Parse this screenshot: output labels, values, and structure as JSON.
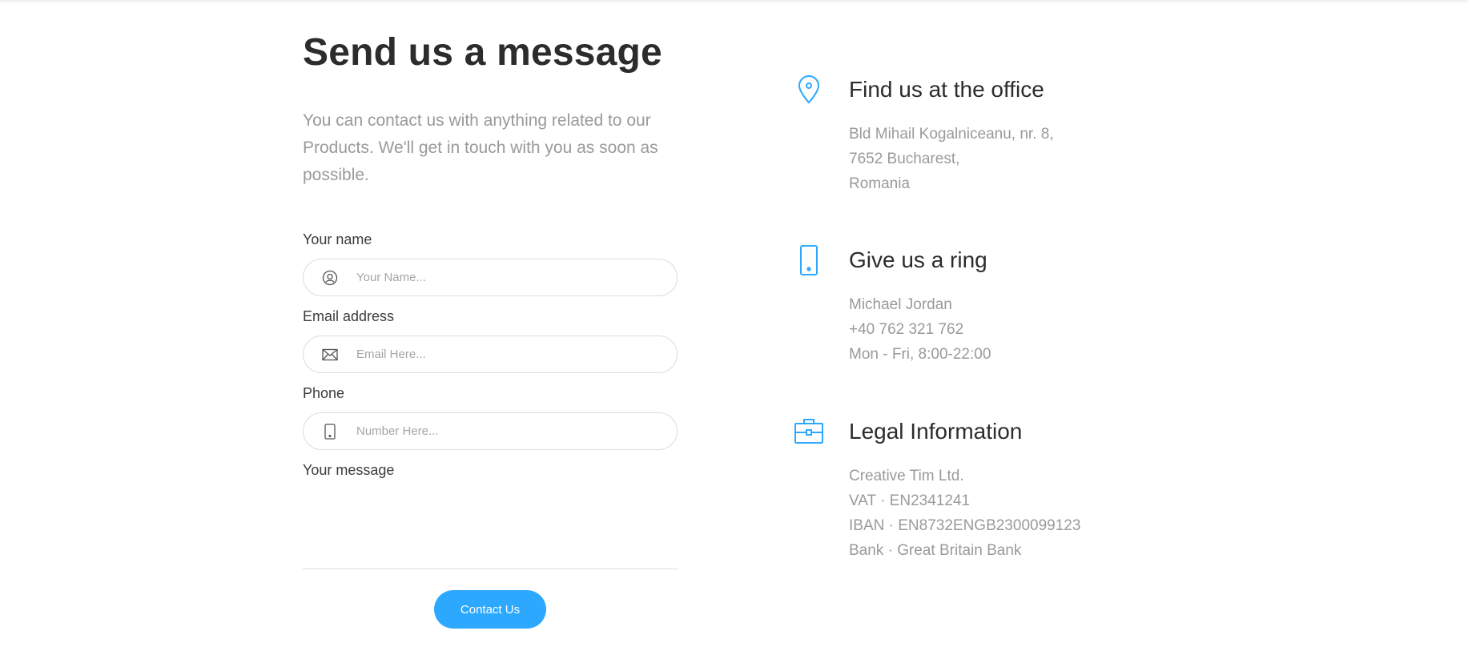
{
  "form": {
    "title": "Send us a message",
    "subtitle": "You can contact us with anything related to our Products. We'll get in touch with you as soon as possible.",
    "name_label": "Your name",
    "name_placeholder": "Your Name...",
    "email_label": "Email address",
    "email_placeholder": "Email Here...",
    "phone_label": "Phone",
    "phone_placeholder": "Number Here...",
    "message_label": "Your message",
    "message_value": "",
    "submit_label": "Contact Us"
  },
  "info": [
    {
      "icon": "map-pin-icon",
      "title": "Find us at the office",
      "lines": [
        "Bld Mihail Kogalniceanu, nr. 8,",
        "7652 Bucharest,",
        "Romania"
      ]
    },
    {
      "icon": "mobile-phone-icon",
      "title": "Give us a ring",
      "lines": [
        "Michael Jordan",
        "+40 762 321 762",
        "Mon - Fri, 8:00-22:00"
      ]
    },
    {
      "icon": "briefcase-icon",
      "title": "Legal Information",
      "lines": [
        "Creative Tim Ltd.",
        "VAT · EN2341241",
        "IBAN · EN8732ENGB2300099123",
        "Bank · Great Britain Bank"
      ]
    }
  ],
  "colors": {
    "accent": "#2ca8ff",
    "heading": "#2c2c2c",
    "muted": "#9a9a9a",
    "border": "#dddddd"
  }
}
